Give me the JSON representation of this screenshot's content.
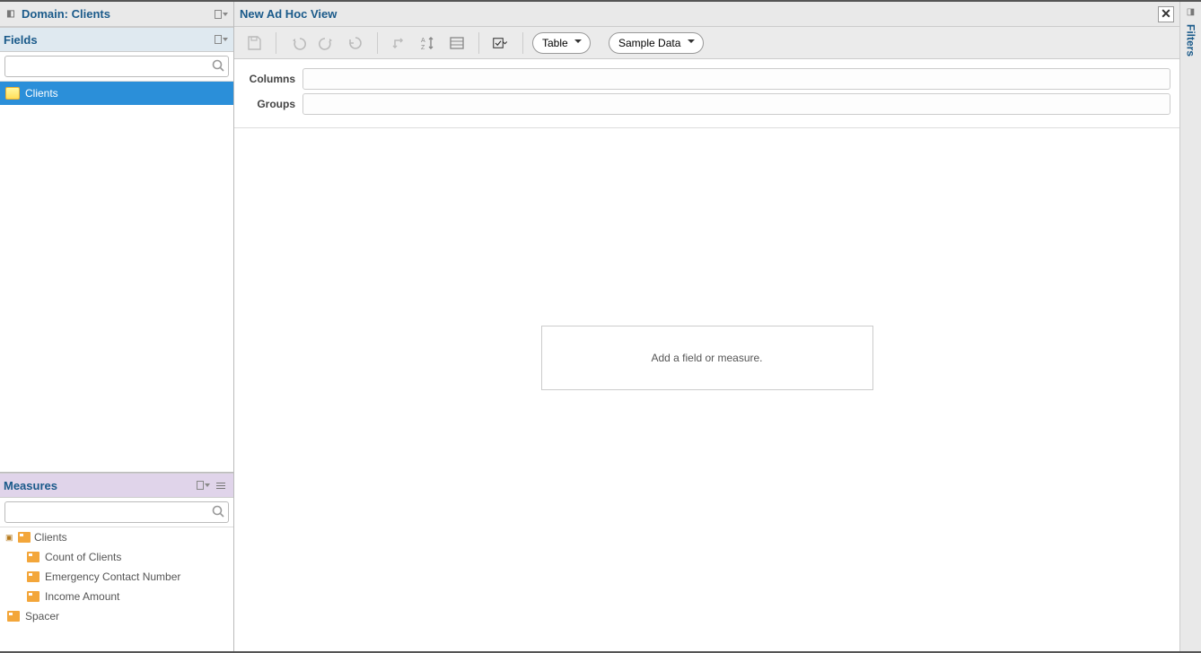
{
  "domain_panel": {
    "title": "Domain: Clients"
  },
  "fields_panel": {
    "title": "Fields",
    "search_placeholder": "",
    "items": [
      {
        "label": "Clients",
        "selected": true
      }
    ]
  },
  "measures_panel": {
    "title": "Measures",
    "search_placeholder": "",
    "groups": [
      {
        "label": "Clients",
        "children": [
          {
            "label": "Count of Clients"
          },
          {
            "label": "Emergency Contact Number"
          },
          {
            "label": "Income Amount"
          }
        ]
      }
    ],
    "extra": [
      {
        "label": "Spacer"
      }
    ]
  },
  "main": {
    "title": "New Ad Hoc View",
    "view_type": "Table",
    "data_mode": "Sample Data",
    "columns_label": "Columns",
    "groups_label": "Groups",
    "placeholder_text": "Add a field or measure."
  },
  "filters": {
    "label": "Filters"
  }
}
